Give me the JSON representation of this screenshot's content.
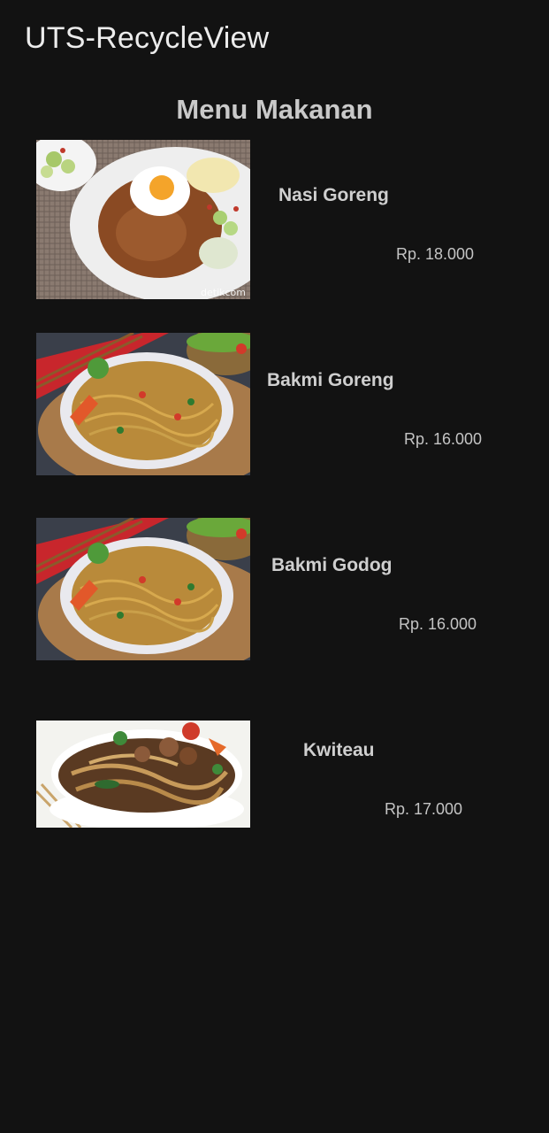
{
  "app": {
    "title": "UTS-RecycleView"
  },
  "heading": "Menu Makanan",
  "menu": [
    {
      "name": "Nasi Goreng",
      "price": "Rp. 18.000",
      "image_icon": "fried-rice-photo",
      "watermark": "detikcom"
    },
    {
      "name": "Bakmi Goreng",
      "price": "Rp. 16.000",
      "image_icon": "fried-noodles-photo"
    },
    {
      "name": "Bakmi Godog",
      "price": "Rp. 16.000",
      "image_icon": "noodles-photo"
    },
    {
      "name": "Kwiteau",
      "price": "Rp. 17.000",
      "image_icon": "kwetiau-photo"
    }
  ],
  "colors": {
    "background": "#121212",
    "text_primary": "#ececec",
    "text_secondary": "#c4c4c4"
  }
}
